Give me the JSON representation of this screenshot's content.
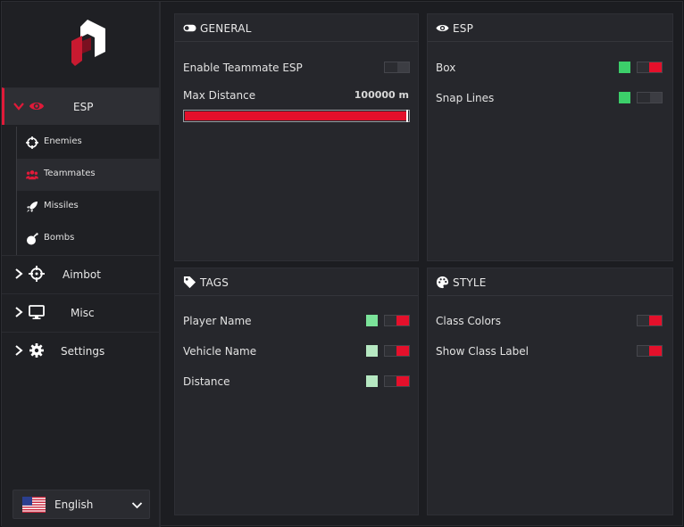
{
  "sidebar": {
    "esp": {
      "label": "ESP",
      "expanded": true
    },
    "sub_items": [
      {
        "label": "Enemies",
        "icon": "crosshair-icon"
      },
      {
        "label": "Teammates",
        "icon": "users-icon",
        "active": true
      },
      {
        "label": "Missiles",
        "icon": "rocket-icon"
      },
      {
        "label": "Bombs",
        "icon": "bomb-icon"
      }
    ],
    "aimbot": {
      "label": "Aimbot"
    },
    "misc": {
      "label": "Misc"
    },
    "settings": {
      "label": "Settings"
    },
    "language": {
      "label": "English"
    }
  },
  "colors": {
    "accent": "#e4102b",
    "swatch_green": "#3ccf6a",
    "swatch_light_green": "#7be39a",
    "swatch_pale_green": "#b6e8c2"
  },
  "general": {
    "title": "GENERAL",
    "enable_teammate_esp": {
      "label": "Enable Teammate ESP",
      "on": false
    },
    "max_distance": {
      "label": "Max Distance",
      "value": "100000 m",
      "fraction": 1.0
    }
  },
  "esp": {
    "title": "ESP",
    "box": {
      "label": "Box",
      "on": true
    },
    "snap_lines": {
      "label": "Snap Lines",
      "on": false
    }
  },
  "tags": {
    "title": "TAGS",
    "player_name": {
      "label": "Player Name",
      "on": true
    },
    "vehicle_name": {
      "label": "Vehicle Name",
      "on": true
    },
    "distance": {
      "label": "Distance",
      "on": true
    }
  },
  "style": {
    "title": "STYLE",
    "class_colors": {
      "label": "Class Colors",
      "on": true
    },
    "show_class_label": {
      "label": "Show Class Label",
      "on": true
    }
  }
}
